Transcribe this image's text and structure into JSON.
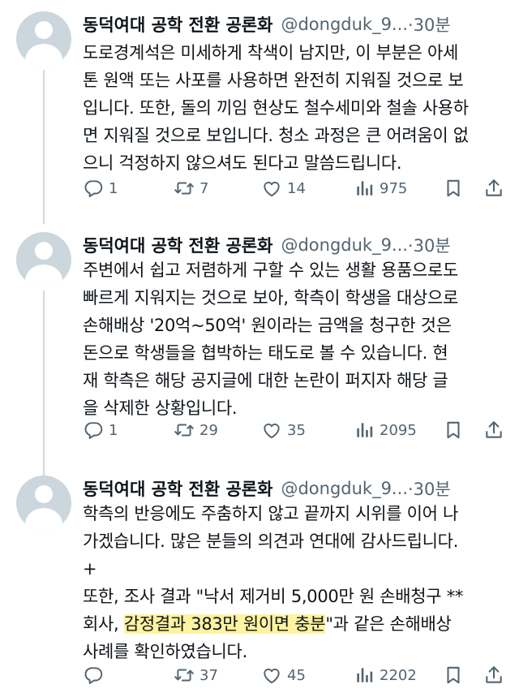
{
  "tweets": [
    {
      "author": "동덕여대 공학 전환 공론화",
      "handle": "@dongduk_9...",
      "time": "·30분",
      "lines": [
        "도로경계석은 미세하게 착색이 남지만, 이 부분은 아세",
        "톤 원액 또는 사포를 사용하면 완전히 지워질 것으로 보",
        "입니다. 또한, 돌의 끼임 현상도 철수세미와 철솔 사용하",
        "면 지워질 것으로 보입니다. 청소 과정은 큰 어려움이 없",
        "으니 걱정하지 않으셔도 된다고 말씀드립니다."
      ],
      "replies": "1",
      "retweets": "7",
      "likes": "14",
      "views": "975"
    },
    {
      "author": "동덕여대 공학 전환 공론화",
      "handle": "@dongduk_9...",
      "time": "·30분",
      "lines": [
        "주변에서 쉽고 저렴하게 구할 수 있는 생활 용품으로도",
        "빠르게 지워지는 것으로 보아, 학측이 학생을 대상으로",
        "손해배상 '20억~50억' 원이라는 금액을 청구한 것은",
        "돈으로 학생들을 협박하는 태도로 볼 수 있습니다. 현",
        "재 학측은 해당 공지글에 대한 논란이 퍼지자 해당 글",
        "을 삭제한 상황입니다."
      ],
      "replies": "1",
      "retweets": "29",
      "likes": "35",
      "views": "2095"
    },
    {
      "author": "동덕여대 공학 전환 공론화",
      "handle": "@dongduk_9...",
      "time": "·30분",
      "lines": [
        "학측의 반응에도 주춤하지 않고 끝까지 시위를 이어 나",
        "가겠습니다. 많은 분들의 의견과 연대에 감사드립니다.",
        "+",
        "또한, 조사 결과 \"낙서 제거비 5,000만 원 손배청구 **"
      ],
      "line5_pre": "회사, ",
      "line5_highlight": "감정결과 383만 원이면 충분",
      "line5_post": "\"과 같은 손해배상",
      "line6": "사례를 확인하였습니다.",
      "replies": "",
      "retweets": "37",
      "likes": "45",
      "views": "2202"
    }
  ],
  "colors": {
    "text": "#0f1419",
    "secondary": "#536471",
    "avatar_bg": "#ccd6dd",
    "highlight": "#fdf3a1"
  },
  "icons": [
    "reply-icon",
    "retweet-icon",
    "like-icon",
    "views-icon",
    "bookmark-icon",
    "share-icon"
  ]
}
